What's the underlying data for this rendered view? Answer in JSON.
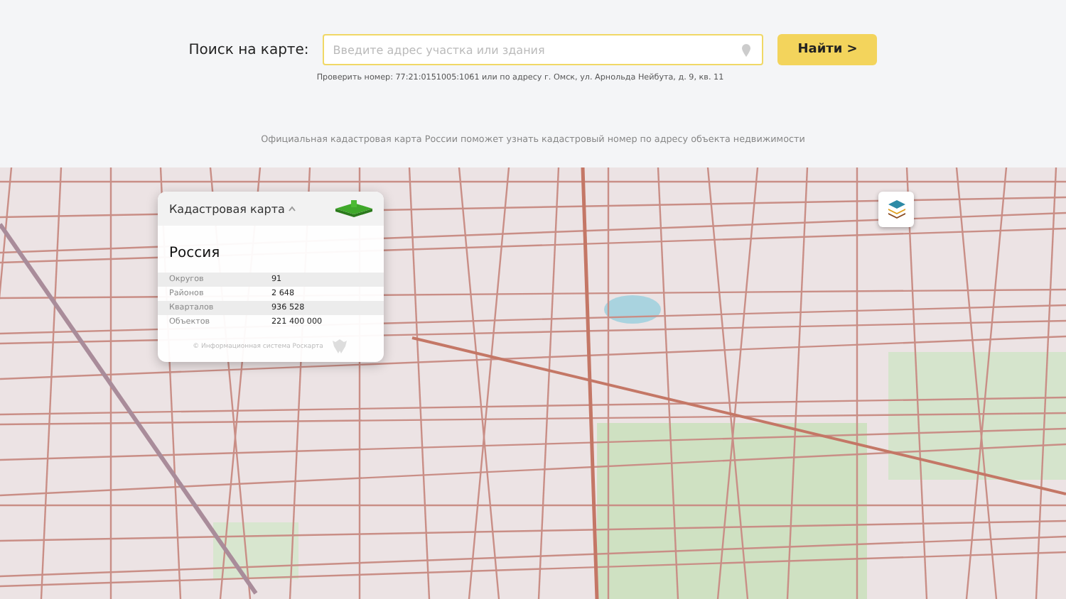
{
  "search": {
    "label": "Поиск на карте:",
    "placeholder": "Введите адрес участка или здания",
    "button": "Найти >",
    "hint": "Проверить номер: 77:21:0151005:1061 или по адресу г. Омск, ул. Арнольда Нейбута, д. 9, кв. 11"
  },
  "tagline": "Официальная кадастровая карта России поможет узнать кадастровый номер по адресу объекта недвижимости",
  "info_panel": {
    "title": "Кадастровая карта",
    "region": "Россия",
    "stats": [
      {
        "label": "Округов",
        "value": "91"
      },
      {
        "label": "Районов",
        "value": "2 648"
      },
      {
        "label": "Кварталов",
        "value": "936 528"
      },
      {
        "label": "Объектов",
        "value": "221 400 000"
      }
    ],
    "footer": "© Информационная система Роскарта"
  }
}
